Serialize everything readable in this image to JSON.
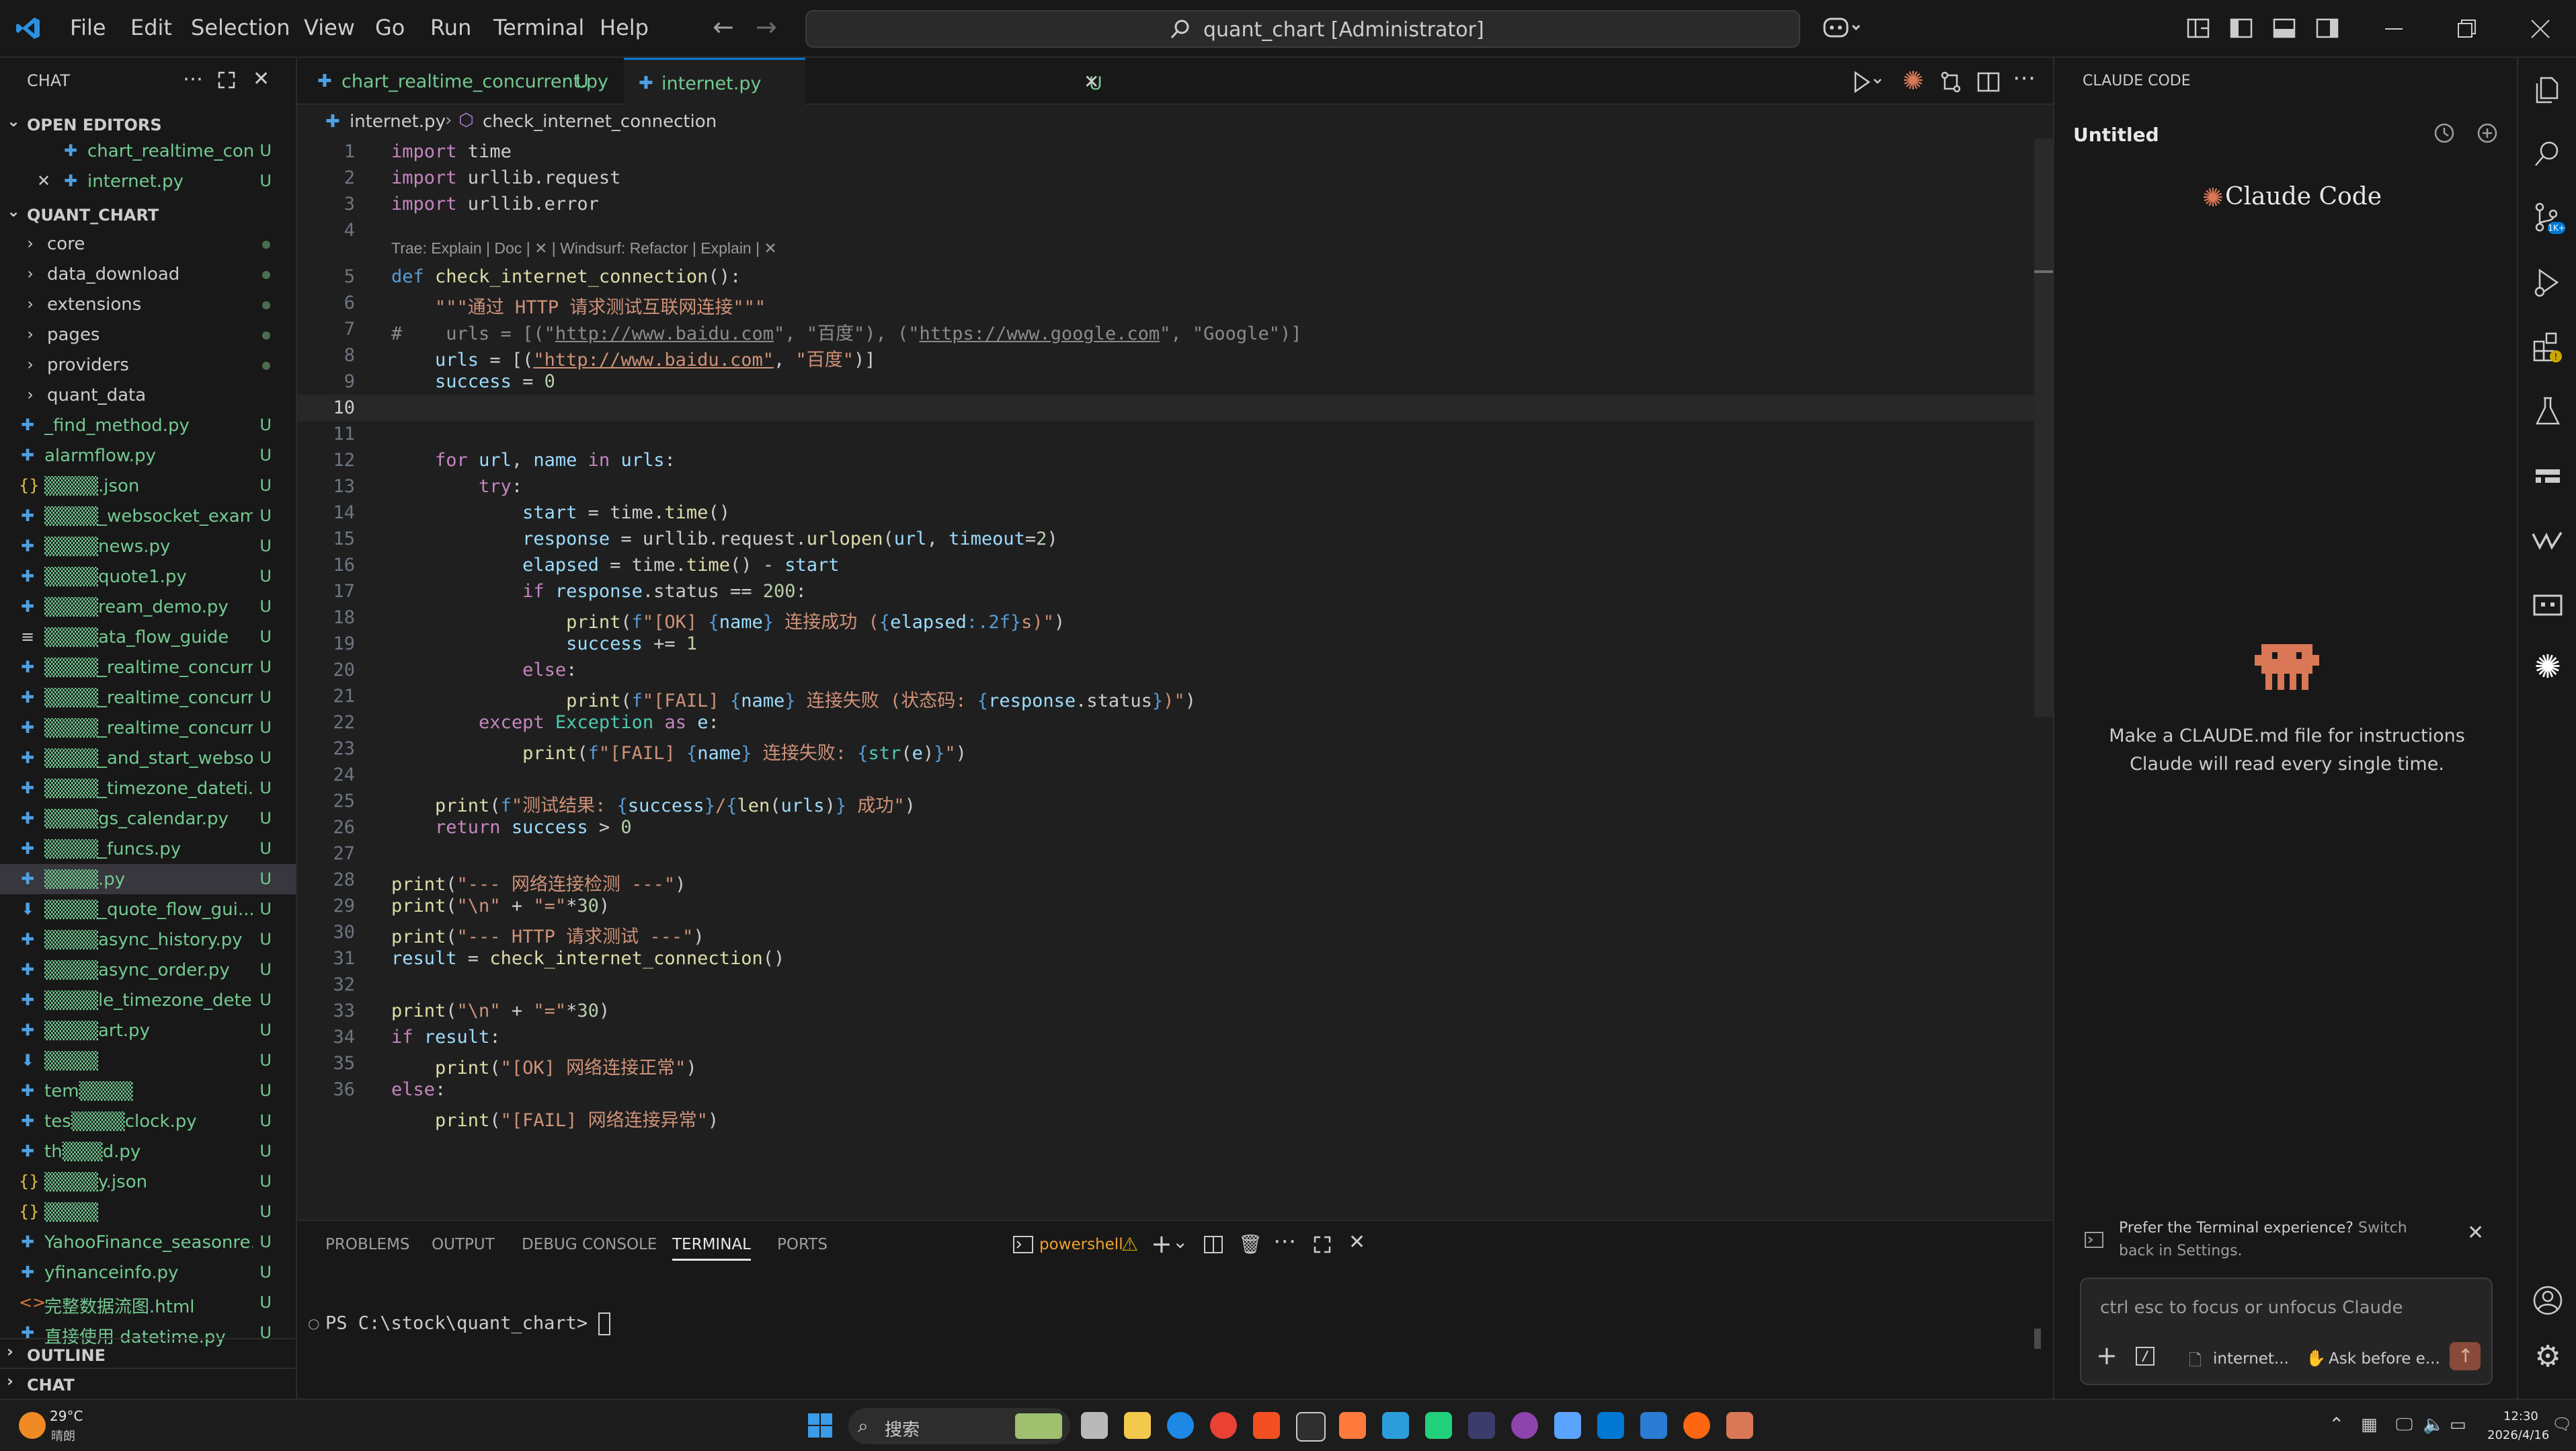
{
  "menu": [
    "File",
    "Edit",
    "Selection",
    "View",
    "Go",
    "Run",
    "Terminal",
    "Help"
  ],
  "search": {
    "text": "quant_chart [Administrator]"
  },
  "sidebar": {
    "header": "CHAT",
    "open_editors_title": "OPEN EDITORS",
    "open_editors": [
      {
        "name": "chart_realtime_con...",
        "badge": "U"
      },
      {
        "name": "internet.py",
        "badge": "U"
      }
    ],
    "folder_title": "QUANT_CHART",
    "folders": [
      "core",
      "data_download",
      "extensions",
      "pages",
      "providers",
      "quant_data"
    ],
    "files": [
      {
        "name": "_find_method.py",
        "badge": "U",
        "icon": "py"
      },
      {
        "name": "alarmflow.py",
        "badge": "U",
        "icon": "py"
      },
      {
        "name": "▒▒▒▒.json",
        "badge": "U",
        "icon": "json"
      },
      {
        "name": "▒▒▒▒_websocket_exam...",
        "badge": "U",
        "icon": "py"
      },
      {
        "name": "▒▒▒▒news.py",
        "badge": "U",
        "icon": "py"
      },
      {
        "name": "▒▒▒▒quote1.py",
        "badge": "U",
        "icon": "py"
      },
      {
        "name": "▒▒▒▒ream_demo.py",
        "badge": "U",
        "icon": "py"
      },
      {
        "name": "▒▒▒▒ata_flow_guide",
        "badge": "U",
        "icon": "txt"
      },
      {
        "name": "▒▒▒▒_realtime_concurre...",
        "badge": "U",
        "icon": "py"
      },
      {
        "name": "▒▒▒▒_realtime_concurre...",
        "badge": "U",
        "icon": "py"
      },
      {
        "name": "▒▒▒▒_realtime_concurre...",
        "badge": "U",
        "icon": "py"
      },
      {
        "name": "▒▒▒▒_and_start_websoc...",
        "badge": "U",
        "icon": "py"
      },
      {
        "name": "▒▒▒▒_timezone_dateti...",
        "badge": "U",
        "icon": "py"
      },
      {
        "name": "▒▒▒▒gs_calendar.py",
        "badge": "U",
        "icon": "py"
      },
      {
        "name": "▒▒▒▒_funcs.py",
        "badge": "U",
        "icon": "py"
      },
      {
        "name": "▒▒▒▒.py",
        "badge": "U",
        "icon": "py"
      },
      {
        "name": "▒▒▒▒_quote_flow_gui...",
        "badge": "U",
        "icon": "md"
      },
      {
        "name": "▒▒▒▒async_history.py",
        "badge": "U",
        "icon": "py"
      },
      {
        "name": "▒▒▒▒async_order.py",
        "badge": "U",
        "icon": "py"
      },
      {
        "name": "▒▒▒▒le_timezone_detect...",
        "badge": "U",
        "icon": "py"
      },
      {
        "name": "▒▒▒▒art.py",
        "badge": "U",
        "icon": "py"
      },
      {
        "name": "▒▒▒▒",
        "badge": "U",
        "icon": "md"
      },
      {
        "name": "tem▒▒▒▒",
        "badge": "U",
        "icon": "py"
      },
      {
        "name": "tes▒▒▒▒clock.py",
        "badge": "U",
        "icon": "py"
      },
      {
        "name": "th▒▒▒d.py",
        "badge": "U",
        "icon": "py"
      },
      {
        "name": "▒▒▒▒y.json",
        "badge": "U",
        "icon": "json"
      },
      {
        "name": "▒▒▒▒",
        "badge": "U",
        "icon": "json"
      },
      {
        "name": "YahooFinance_seasonre...",
        "badge": "U",
        "icon": "py"
      },
      {
        "name": "yfinanceinfo.py",
        "badge": "U",
        "icon": "py"
      },
      {
        "name": "完整数据流图.html",
        "badge": "U",
        "icon": "html"
      },
      {
        "name": "直接使用 datetime.py",
        "badge": "U",
        "icon": "py"
      }
    ],
    "outline_title": "OUTLINE",
    "chat_title": "CHAT"
  },
  "tabs": [
    {
      "name": "chart_realtime_concurrent.py",
      "badge": "U"
    },
    {
      "name": "internet.py",
      "badge": "U"
    }
  ],
  "breadcrumb": {
    "file": "internet.py",
    "symbol": "check_internet_connection"
  },
  "editor": {
    "codelens": "Trae: Explain | Doc | ✕ | Windsurf: Refactor | Explain | ✕",
    "line_numbers": [
      "1",
      "2",
      "3",
      "4",
      "5",
      "6",
      "7",
      "8",
      "9",
      "10",
      "11",
      "12",
      "13",
      "14",
      "15",
      "16",
      "17",
      "18",
      "19",
      "20",
      "21",
      "22",
      "23",
      "24",
      "25",
      "26",
      "27",
      "28",
      "29",
      "30",
      "31",
      "32",
      "33",
      "34",
      "35",
      "36"
    ]
  },
  "panel": {
    "tabs": [
      "PROBLEMS",
      "OUTPUT",
      "DEBUG CONSOLE",
      "TERMINAL",
      "PORTS"
    ],
    "shell": "powershell",
    "prompt": "PS C:\\stock\\quant_chart> "
  },
  "claude": {
    "header": "CLAUDE CODE",
    "session": "Untitled",
    "brand": "Claude Code",
    "hint": "Make a CLAUDE.md file for instructions Claude will read every single time.",
    "notice": "Prefer the Terminal experience?",
    "notice_link": "Switch back in Settings.",
    "input_placeholder": "ctrl esc to focus or unfocus Claude",
    "file_chip": "internet...",
    "mode_chip": "Ask before e..."
  },
  "taskbar": {
    "weather_temp": "29°C",
    "weather_desc": "晴朗",
    "search_label": "搜索",
    "time": "12:30",
    "date": "2026/4/16"
  },
  "colors": {
    "accent": "#0078d4",
    "modified_green": "#73c991",
    "claude_orange": "#d97757"
  }
}
